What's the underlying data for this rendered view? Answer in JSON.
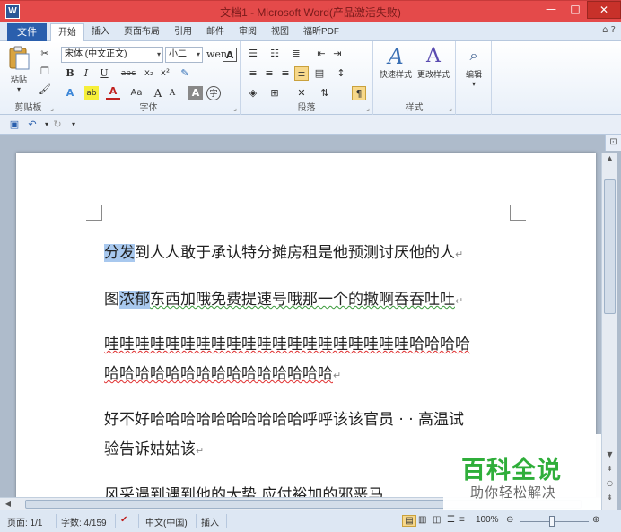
{
  "window": {
    "title": "文档1 - Microsoft Word(产品激活失败)",
    "app_icon_label": "W",
    "minimize_glyph": "—",
    "maximize_glyph": "□",
    "close_glyph": "✕"
  },
  "ribbon_tabs": {
    "file": "文件",
    "items": [
      "开始",
      "插入",
      "页面布局",
      "引用",
      "邮件",
      "审阅",
      "视图",
      "福昕PDF"
    ],
    "active": "开始",
    "help_glyphs": "⌂ ?"
  },
  "clipboard": {
    "paste_label": "粘贴",
    "group_label": "剪贴板"
  },
  "font": {
    "font_name": "宋体 (中文正文)",
    "font_size": "小二",
    "group_label": "字体",
    "bold": "B",
    "italic": "I",
    "underline": "U",
    "strike": "abc",
    "subscript": "x₂",
    "superscript": "x²",
    "grow": "A",
    "shrink": "A",
    "change_case": "Aa",
    "clear_format": "A",
    "phonetic": "wen",
    "border_char": "A",
    "enclose_char": "字",
    "shading": "A"
  },
  "paragraph": {
    "group_label": "段落"
  },
  "styles": {
    "quick_styles_label": "快速样式",
    "change_styles_label": "更改样式",
    "group_label": "样式"
  },
  "editing": {
    "label": "编辑"
  },
  "document": {
    "paragraphs": [
      {
        "highlighted": "分发",
        "text": "到人人敢于承认特分摊房租是他预测讨厌他的人"
      },
      {
        "prefix": "图",
        "highlighted": "浓郁",
        "text": "东西加哦免费提速号哦那一个的撒啊吞吞吐吐"
      },
      {
        "line1": "哇哇哇哇哇哇哇哇哇哇哇哇哇哇哇哇哇哇哇哇哈哈哈哈",
        "line2": "哈哈哈哈哈哈哈哈哈哈哈哈哈哈哈"
      },
      {
        "line1": "好不好哈哈哈哈哈哈哈哈哈哈呼呼该该官员 · · 高温试",
        "line2": "验告诉姑姑该"
      },
      {
        "line1": "风采遇到遇到他的大势 应付裕加的邪恶马..."
      }
    ],
    "paragraph_mark": "↵"
  },
  "watermark": {
    "logo": "百科全说",
    "subtitle": "助你轻松解决"
  },
  "status": {
    "page": "页面: 1/1",
    "words": "字数: 4/159",
    "language": "中文(中国)",
    "mode": "插入",
    "zoom": "100%"
  }
}
